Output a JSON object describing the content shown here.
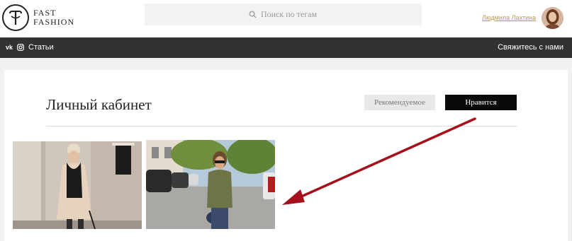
{
  "header": {
    "logo_line1": "FAST",
    "logo_line2": "FASHION",
    "search_placeholder": "Поиск по тегам",
    "user_name": "Людмила Лахтина"
  },
  "nav": {
    "vk": "vk",
    "articles": "Статьи",
    "contact": "Свяжитесь с нами"
  },
  "page": {
    "title": "Личный кабинет",
    "tab_recommended": "Рекомендуемое",
    "tab_liked": "Нравится"
  },
  "colors": {
    "accent_link": "#b8964f",
    "navbar": "#323232",
    "active_tab": "#0a0a0a",
    "arrow": "#a5101c"
  },
  "icons": [
    "logo-icon",
    "search-icon",
    "vk-icon",
    "instagram-icon"
  ]
}
